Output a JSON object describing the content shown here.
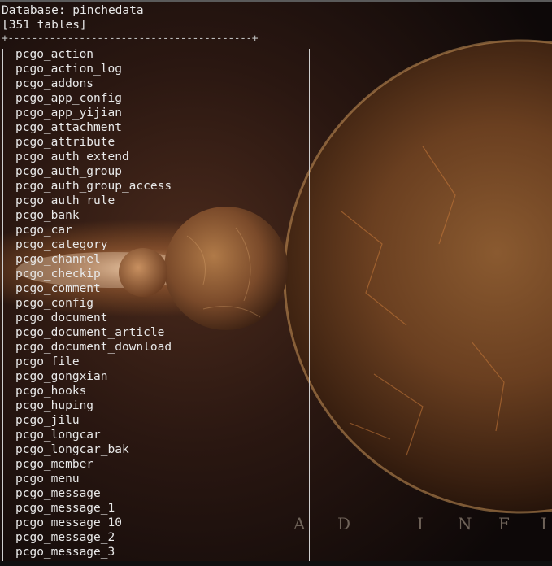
{
  "terminal": {
    "database_line": "Database: pinchedata",
    "count_line": "[351 tables]",
    "border_top": "+-----------------------------------------+",
    "tables": [
      "pcgo_action",
      "pcgo_action_log",
      "pcgo_addons",
      "pcgo_app_config",
      "pcgo_app_yijian",
      "pcgo_attachment",
      "pcgo_attribute",
      "pcgo_auth_extend",
      "pcgo_auth_group",
      "pcgo_auth_group_access",
      "pcgo_auth_rule",
      "pcgo_bank",
      "pcgo_car",
      "pcgo_category",
      "pcgo_channel",
      "pcgo_checkip",
      "pcgo_comment",
      "pcgo_config",
      "pcgo_document",
      "pcgo_document_article",
      "pcgo_document_download",
      "pcgo_file",
      "pcgo_gongxian",
      "pcgo_hooks",
      "pcgo_huping",
      "pcgo_jilu",
      "pcgo_longcar",
      "pcgo_longcar_bak",
      "pcgo_member",
      "pcgo_menu",
      "pcgo_message",
      "pcgo_message_1",
      "pcgo_message_10",
      "pcgo_message_2",
      "pcgo_message_3"
    ]
  },
  "wallpaper": {
    "banner_letters": [
      "A",
      "D",
      "I",
      "N",
      "F",
      "I"
    ]
  },
  "colors": {
    "terminal_text": "#e8e8e8",
    "background": "#1a0f0a",
    "planet_glow": "#c8742e"
  }
}
